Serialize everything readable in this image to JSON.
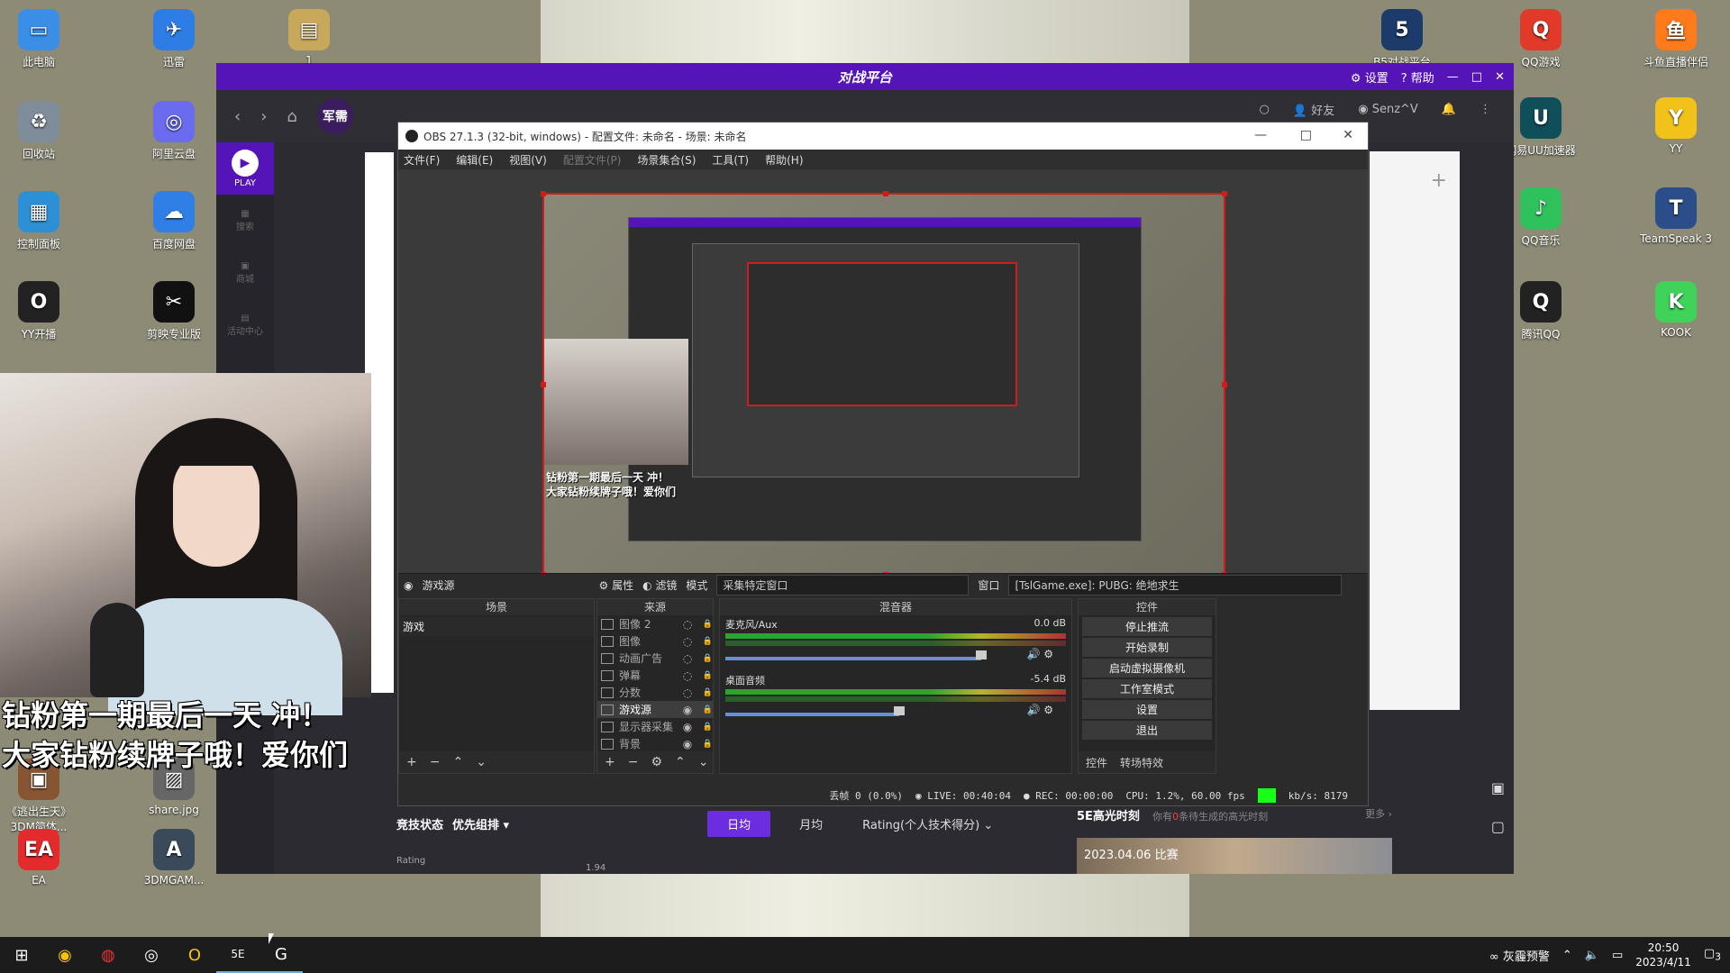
{
  "desktop": {
    "left_icons": [
      {
        "label": "此电脑",
        "glyph": "▭",
        "color": "#3a8ee6",
        "icon": "computer-icon"
      },
      {
        "label": "迅雷",
        "glyph": "✈",
        "color": "#2e7de6",
        "icon": "thunder-icon"
      },
      {
        "label": "1",
        "glyph": "▤",
        "color": "#c8a85a",
        "icon": "folder-icon"
      },
      {
        "label": "回收站",
        "glyph": "♻",
        "color": "#7f8c99",
        "icon": "recycle-bin-icon"
      },
      {
        "label": "阿里云盘",
        "glyph": "◎",
        "color": "#6b6bf0",
        "icon": "aliyun-drive-icon"
      },
      {
        "label": "控制面板",
        "glyph": "▦",
        "color": "#2d8fd6",
        "icon": "control-panel-icon"
      },
      {
        "label": "百度网盘",
        "glyph": "☁",
        "color": "#2f7fe6",
        "icon": "baidu-netdisk-icon"
      },
      {
        "label": "YY开播",
        "glyph": "O",
        "color": "#222",
        "icon": "yy-live-icon"
      },
      {
        "label": "剪映专业版",
        "glyph": "✂",
        "color": "#111",
        "icon": "jianying-icon"
      },
      {
        "label": "《逃出生天》3DM简体...",
        "glyph": "▣",
        "color": "#885533",
        "icon": "game-shortcut-icon"
      },
      {
        "label": "share.jpg",
        "glyph": "▨",
        "color": "#666",
        "icon": "image-file-icon"
      },
      {
        "label": "EA",
        "glyph": "EA",
        "color": "#e42b2b",
        "icon": "ea-icon"
      },
      {
        "label": "3DMGAM...",
        "glyph": "A",
        "color": "#3a4a5a",
        "icon": "3dm-game-icon"
      }
    ],
    "right_icons": [
      {
        "label": "B5对战平台",
        "glyph": "5",
        "color": "#1c3a6a",
        "icon": "b5-platform-icon"
      },
      {
        "label": "QQ游戏",
        "glyph": "Q",
        "color": "#e23a2a",
        "icon": "qq-game-icon"
      },
      {
        "label": "斗鱼直播伴侣",
        "glyph": "鱼",
        "color": "#ff7a1a",
        "icon": "douyu-icon"
      },
      {
        "label": "网易UU加速器",
        "glyph": "U",
        "color": "#0e4f5a",
        "icon": "uu-booster-icon"
      },
      {
        "label": "YY",
        "glyph": "Y",
        "color": "#f2c21a",
        "icon": "yy-icon"
      },
      {
        "label": "QQ音乐",
        "glyph": "♪",
        "color": "#2fc15b",
        "icon": "qq-music-icon"
      },
      {
        "label": "TeamSpeak 3",
        "glyph": "T",
        "color": "#2b4e8a",
        "icon": "teamspeak-icon"
      },
      {
        "label": "腾讯QQ",
        "glyph": "Q",
        "color": "#222",
        "icon": "qq-icon"
      },
      {
        "label": "KOOK",
        "glyph": "K",
        "color": "#3fd35a",
        "icon": "kook-icon"
      }
    ]
  },
  "platform": {
    "brand": "对战平台",
    "settings": "设置",
    "help": "帮助",
    "nav_badge": "军需",
    "friends": "好友",
    "username": "Senz^V",
    "side_play": "PLAY",
    "side_items": [
      "搜索",
      "商城",
      "活动中心"
    ],
    "tabs": {
      "state_label": "竞技状态",
      "filter_label": "优先组排",
      "daily": "日均",
      "monthly": "月均",
      "rating_select": "Rating(个人技术得分)"
    },
    "chart_label": "Rating",
    "chart_value": "1.94",
    "highlights": {
      "title": "5E高光时刻",
      "prefix": "你有",
      "count": "0",
      "suffix": "条待生成的高光时刻",
      "more": "更多",
      "card_label": "2023.04.06 比赛"
    }
  },
  "obs": {
    "title": "OBS 27.1.3 (32-bit, windows) - 配置文件: 未命名 - 场景: 未命名",
    "menu": [
      "文件(F)",
      "编辑(E)",
      "视图(V)",
      "配置文件(P)",
      "场景集合(S)",
      "工具(T)",
      "帮助(H)"
    ],
    "preview_overlay": "钻粉第一期最后一天 冲！\n大家钻粉续牌子哦！爱你们",
    "source_bar": {
      "source_name": "游戏源",
      "properties": "属性",
      "filters": "滤镜",
      "mode_label": "模式",
      "mode_value": "采集特定窗口",
      "window_label": "窗口",
      "window_value": "[TslGame.exe]: PUBG: 绝地求生"
    },
    "scenes": {
      "title": "场景",
      "items": [
        "游戏"
      ]
    },
    "sources": {
      "title": "来源",
      "items": [
        {
          "name": "图像 2",
          "visible": "hidden",
          "selected": false
        },
        {
          "name": "图像",
          "visible": "hidden",
          "selected": false
        },
        {
          "name": "动画广告",
          "visible": "hidden",
          "selected": false
        },
        {
          "name": "弹幕",
          "visible": "hidden",
          "selected": false
        },
        {
          "name": "分数",
          "visible": "hidden",
          "selected": false
        },
        {
          "name": "游戏源",
          "visible": "shown",
          "selected": true
        },
        {
          "name": "显示器采集",
          "visible": "shown",
          "selected": false
        },
        {
          "name": "背景",
          "visible": "shown",
          "selected": false
        }
      ]
    },
    "mixer": {
      "title": "混音器",
      "tracks": [
        {
          "name": "麦克风/Aux",
          "db": "0.0 dB",
          "level": 0.92
        },
        {
          "name": "桌面音频",
          "db": "-5.4 dB",
          "level": 0.62
        }
      ]
    },
    "controls": {
      "title": "控件",
      "buttons": [
        "停止推流",
        "开始录制",
        "启动虚拟摄像机",
        "工作室模式",
        "设置",
        "退出"
      ],
      "tabs": [
        "控件",
        "转场特效"
      ]
    },
    "status": {
      "dropped": "丢帧 0 (0.0%)",
      "live": "LIVE: 00:40:04",
      "rec": "REC: 00:00:00",
      "cpu": "CPU: 1.2%, 60.00 fps",
      "kbs": "kb/s: 8179"
    }
  },
  "webcam_caption": [
    "钻粉第一期最后一天 冲！",
    "大家钻粉续牌子哦！爱你们"
  ],
  "taskbar": {
    "weather": "灰霾预警",
    "time": "20:50",
    "date": "2023/4/11",
    "notifications": "3"
  }
}
